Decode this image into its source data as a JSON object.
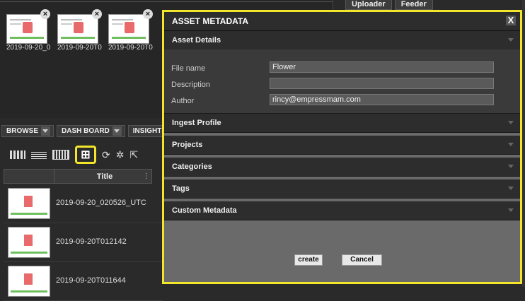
{
  "top_tabs": [
    "Uploader",
    "Feeder"
  ],
  "thumbnails": [
    {
      "label": "2019-09-20_0"
    },
    {
      "label": "2019-09-20T0"
    },
    {
      "label": "2019-09-20T0"
    }
  ],
  "nav_tabs": [
    "BROWSE",
    "DASH BOARD",
    "INSIGHTS"
  ],
  "table": {
    "column_title": "Title",
    "rows": [
      {
        "title": "2019-09-20_020526_UTC"
      },
      {
        "title": "2019-09-20T012142"
      },
      {
        "title": "2019-09-20T011644"
      }
    ]
  },
  "modal": {
    "title": "ASSET METADATA",
    "close": "X",
    "sections": {
      "asset_details": "Asset Details",
      "ingest_profile": "Ingest Profile",
      "projects": "Projects",
      "categories": "Categories",
      "tags": "Tags",
      "custom_metadata": "Custom Metadata"
    },
    "fields": {
      "file_name_label": "File name",
      "file_name_value": "Flower",
      "description_label": "Description",
      "description_value": "",
      "author_label": "Author",
      "author_value": "rincy@empressmam.com"
    },
    "create_label": "create",
    "cancel_label": "Cancel"
  },
  "colors": {
    "highlight": "#f3e62a",
    "panel_dark": "#2d2d2d",
    "modal_body": "#6a6a6a"
  }
}
